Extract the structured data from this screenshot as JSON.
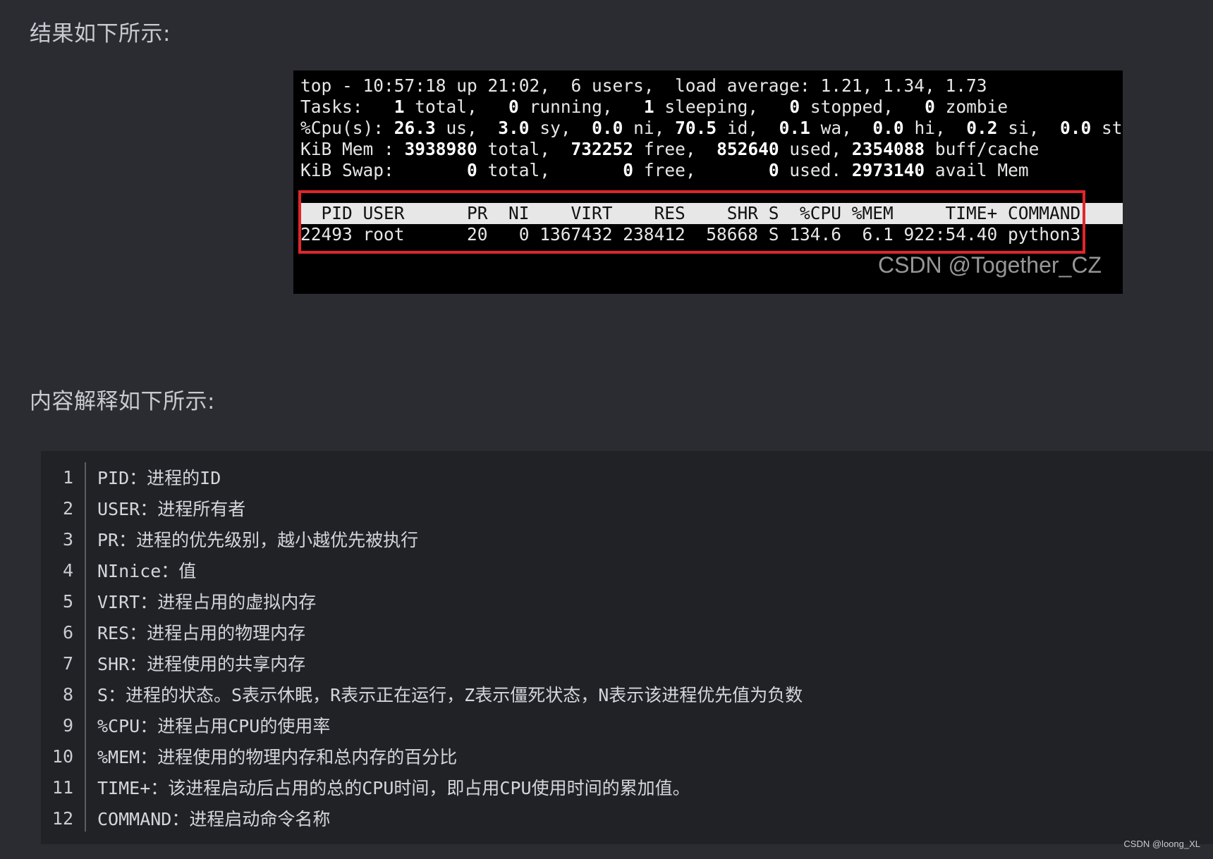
{
  "headings": {
    "result": "结果如下所示:",
    "explain": "内容解释如下所示:"
  },
  "terminal": {
    "line1": "top - 10:57:18 up 21:02,  6 users,  load average: 1.21, 1.34, 1.73",
    "line2": {
      "a": "Tasks:   ",
      "b1": "1",
      "c1": " total,   ",
      "b2": "0",
      "c2": " running,   ",
      "b3": "1",
      "c3": " sleeping,   ",
      "b4": "0",
      "c4": " stopped,   ",
      "b5": "0",
      "c5": " zombie"
    },
    "line3": {
      "a": "%Cpu(s): ",
      "b1": "26.3",
      "c1": " us,  ",
      "b2": "3.0",
      "c2": " sy,  ",
      "b3": "0.0",
      "c3": " ni, ",
      "b4": "70.5",
      "c4": " id,  ",
      "b5": "0.1",
      "c5": " wa,  ",
      "b6": "0.0",
      "c6": " hi,  ",
      "b7": "0.2",
      "c7": " si,  ",
      "b8": "0.0",
      "c8": " st"
    },
    "line4": {
      "a": "KiB Mem : ",
      "b1": "3938980",
      "c1": " total,  ",
      "b2": "732252",
      "c2": " free,  ",
      "b3": "852640",
      "c3": " used, ",
      "b4": "2354088",
      "c4": " buff/cache"
    },
    "line5": {
      "a": "KiB Swap:       ",
      "b1": "0",
      "c1": " total,       ",
      "b2": "0",
      "c2": " free,       ",
      "b3": "0",
      "c3": " used. ",
      "b4": "2973140",
      "c4": " avail Mem"
    },
    "proc_header": "  PID USER      PR  NI    VIRT    RES    SHR S  %CPU %MEM     TIME+ COMMAND",
    "proc_row": "22493 root      20   0 1367432 238412  58668 S 134.6  6.1 922:54.40 python3",
    "watermark": "CSDN @Together_CZ"
  },
  "code_lines": [
    {
      "no": "1",
      "text": "PID：进程的ID"
    },
    {
      "no": "2",
      "text": "USER：进程所有者"
    },
    {
      "no": "3",
      "text": "PR：进程的优先级别，越小越优先被执行"
    },
    {
      "no": "4",
      "text": "NInice：值"
    },
    {
      "no": "5",
      "text": "VIRT：进程占用的虚拟内存"
    },
    {
      "no": "6",
      "text": "RES：进程占用的物理内存"
    },
    {
      "no": "7",
      "text": "SHR：进程使用的共享内存"
    },
    {
      "no": "8",
      "text": "S：进程的状态。S表示休眠，R表示正在运行，Z表示僵死状态，N表示该进程优先值为负数"
    },
    {
      "no": "9",
      "text": "%CPU：进程占用CPU的使用率"
    },
    {
      "no": "10",
      "text": "%MEM：进程使用的物理内存和总内存的百分比"
    },
    {
      "no": "11",
      "text": "TIME+：该进程启动后占用的总的CPU时间，即占用CPU使用时间的累加值。"
    },
    {
      "no": "12",
      "text": "COMMAND：进程启动命令名称"
    }
  ],
  "page_watermark": "CSDN @loong_XL"
}
